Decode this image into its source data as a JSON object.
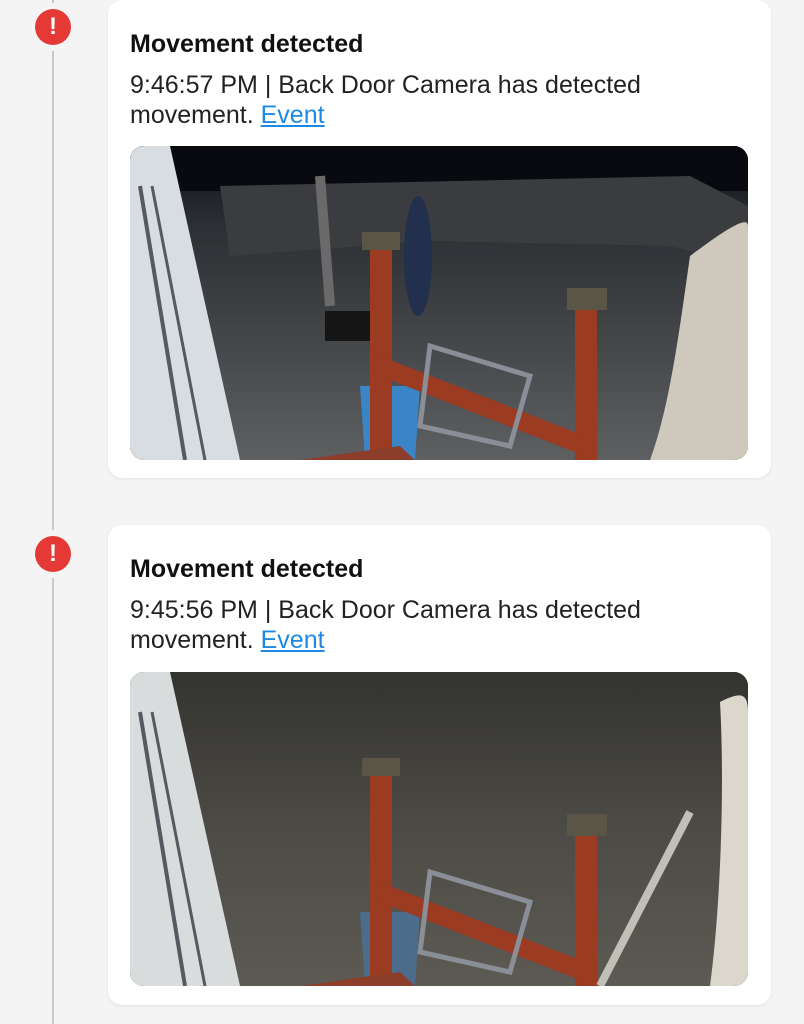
{
  "events": [
    {
      "icon": "!",
      "title": "Movement detected",
      "time": "9:46:57 PM",
      "separator": "|",
      "message": "Back Door Camera has detected movement.",
      "link_label": "Event"
    },
    {
      "icon": "!",
      "title": "Movement detected",
      "time": "9:45:56 PM",
      "separator": "|",
      "message": "Back Door Camera has detected movement.",
      "link_label": "Event"
    }
  ],
  "colors": {
    "alert": "#e53935",
    "link": "#1e88e5",
    "background": "#f4f4f4"
  }
}
